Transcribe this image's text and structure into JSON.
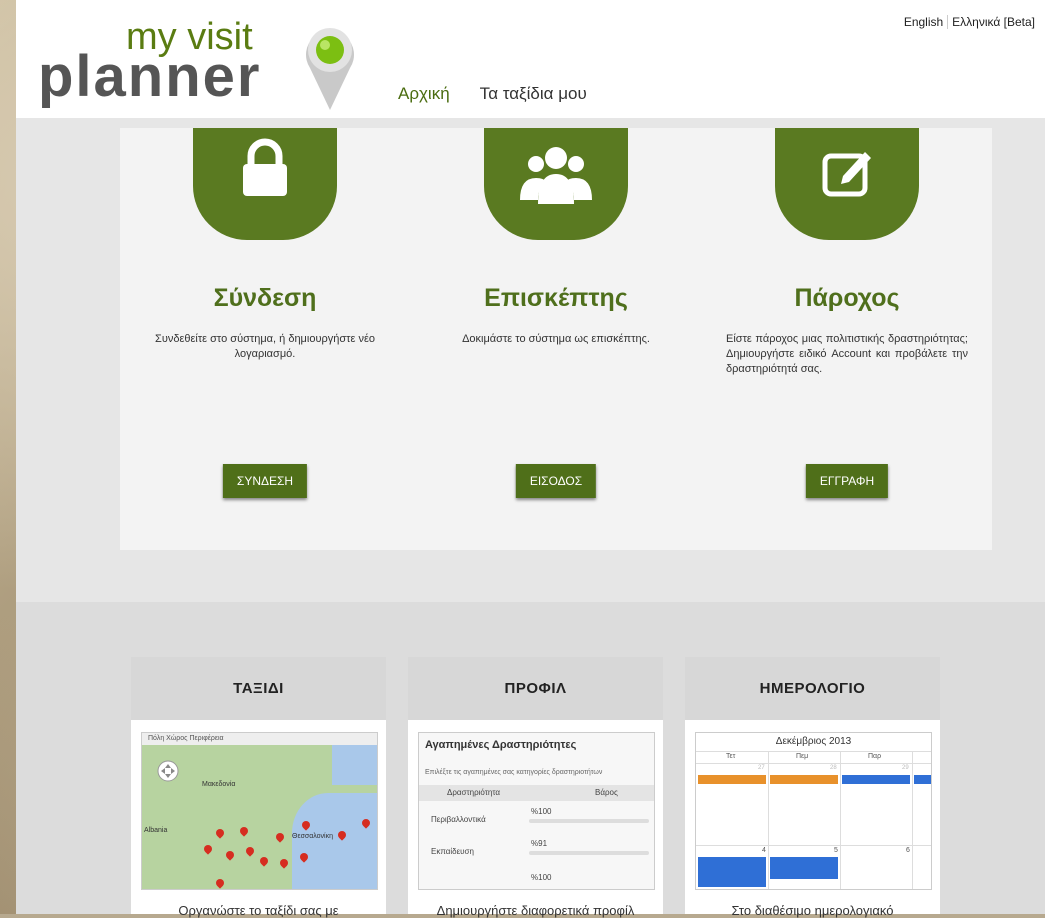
{
  "header": {
    "logo_top": "my visit",
    "logo_bottom": "planner",
    "nav": [
      "Αρχική",
      "Τα ταξίδια μου"
    ],
    "lang": [
      "English",
      "Ελληνικά [Beta]"
    ]
  },
  "columns": [
    {
      "title": "Σύνδεση",
      "text": "Συνδεθείτε στο σύστημα, ή δημιουργήστε νέο λογαριασμό.",
      "button": "ΣΥΝΔΕΣΗ",
      "icon": "lock-icon"
    },
    {
      "title": "Επισκέπτης",
      "text": "Δοκιμάστε το σύστημα ως επισκέπτης.",
      "button": "ΕΙΣΟΔΟΣ",
      "icon": "users-icon"
    },
    {
      "title": "Πάροχος",
      "text": "Είστε πάροχος μιας πολιτιστικής δραστηριότητας; Δημιουργήστε ειδικό Account και προβάλετε την δραστηριότητά σας.",
      "button": "ΕΓΓΡΑΦΗ",
      "icon": "edit-icon"
    }
  ],
  "cards": [
    {
      "title": "ΤΑΞΙΔΙ",
      "text": "Οργανώστε το ταξίδι σας με"
    },
    {
      "title": "ΠΡΟΦΙΛ",
      "text": "Δημιουργήστε διαφορετικά προφίλ"
    },
    {
      "title": "ΗΜΕΡΟΛΟΓΙΟ",
      "text": "Στο διαθέσιμο ημερολογιακό"
    }
  ],
  "map": {
    "controls": "Πόλη  Χώρος   Περιφέρεια",
    "labels": [
      "Μακεδονία",
      "Θεσσαλονίκη",
      "Albania"
    ]
  },
  "profile": {
    "title": "Αγαπημένες Δραστηριότητες",
    "subtitle": "Επιλέξτε τις αγαπημένες σας κατηγορίες δραστηριοτήτων",
    "col1": "Δραστηριότητα",
    "col2": "Βάρος",
    "rows": [
      {
        "name": "Περιβαλλοντικά",
        "value": "%100"
      },
      {
        "name": "Εκπαίδευση",
        "value": "%91"
      },
      {
        "name": "",
        "value": "%100"
      }
    ]
  },
  "calendar": {
    "month": "Δεκέμβριος 2013",
    "days": [
      "Τετ",
      "Πεμ",
      "Παρ"
    ],
    "dates": [
      "27",
      "28",
      "29",
      "4",
      "5",
      "6"
    ]
  },
  "colors": {
    "green": "#5a7a21",
    "button": "#4f6f19"
  }
}
